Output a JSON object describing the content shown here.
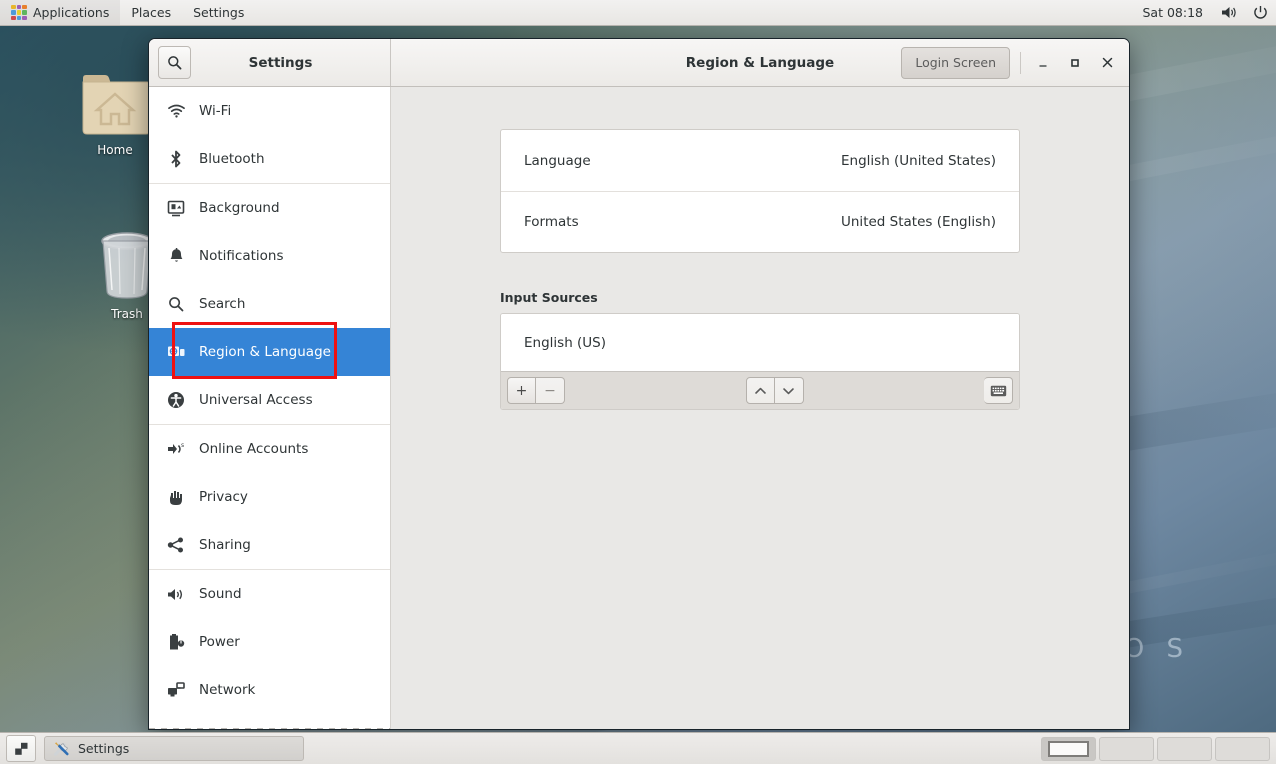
{
  "top_panel": {
    "apps_label": "Applications",
    "places_label": "Places",
    "settings_label": "Settings",
    "clock": "Sat 08:18",
    "volume_icon": "volume-icon",
    "power_icon": "power-icon",
    "apps_icon": "applications-grid-icon"
  },
  "desktop": {
    "icons": [
      {
        "name": "home-folder",
        "label": "Home"
      },
      {
        "name": "trash",
        "label": "Trash"
      }
    ],
    "wallpaper_text": "O S"
  },
  "window": {
    "app_title": "Settings",
    "page_title": "Region & Language",
    "login_screen_label": "Login Screen",
    "search_icon": "search-icon",
    "minimize_icon": "minimize-icon",
    "maximize_icon": "maximize-icon",
    "close_icon": "close-icon"
  },
  "sidebar": {
    "items": [
      {
        "label": "Wi-Fi",
        "icon": "wifi-icon",
        "selected": false
      },
      {
        "label": "Bluetooth",
        "icon": "bluetooth-icon",
        "selected": false
      },
      {
        "label": "Background",
        "icon": "background-icon",
        "selected": false
      },
      {
        "label": "Notifications",
        "icon": "bell-icon",
        "selected": false
      },
      {
        "label": "Search",
        "icon": "search-icon",
        "selected": false
      },
      {
        "label": "Region & Language",
        "icon": "region-language-icon",
        "selected": true
      },
      {
        "label": "Universal Access",
        "icon": "accessibility-icon",
        "selected": false
      },
      {
        "label": "Online Accounts",
        "icon": "online-accounts-icon",
        "selected": false
      },
      {
        "label": "Privacy",
        "icon": "hand-icon",
        "selected": false
      },
      {
        "label": "Sharing",
        "icon": "share-icon",
        "selected": false
      },
      {
        "label": "Sound",
        "icon": "speaker-icon",
        "selected": false
      },
      {
        "label": "Power",
        "icon": "battery-icon",
        "selected": false
      },
      {
        "label": "Network",
        "icon": "network-icon",
        "selected": false
      }
    ]
  },
  "main": {
    "rows": [
      {
        "label": "Language",
        "value": "English (United States)"
      },
      {
        "label": "Formats",
        "value": "United States (English)"
      }
    ],
    "input_sources": {
      "section_label": "Input Sources",
      "items": [
        "English (US)"
      ],
      "toolbar": {
        "add_label": "+",
        "remove_label": "−",
        "move_up_icon": "chevron-up-icon",
        "move_down_icon": "chevron-down-icon",
        "keyboard_preview_icon": "keyboard-icon"
      }
    }
  },
  "taskbar": {
    "show_desktop_icon": "show-desktop-icon",
    "task_label": "Settings",
    "task_icon": "tools-icon",
    "workspaces": [
      {
        "active": true
      },
      {
        "active": false
      },
      {
        "active": false
      },
      {
        "active": false
      }
    ]
  },
  "colors": {
    "accent_selection": "#3584d6",
    "highlight_box": "#ee1111",
    "window_bg": "#f6f5f4",
    "main_bg": "#e9e8e6"
  }
}
